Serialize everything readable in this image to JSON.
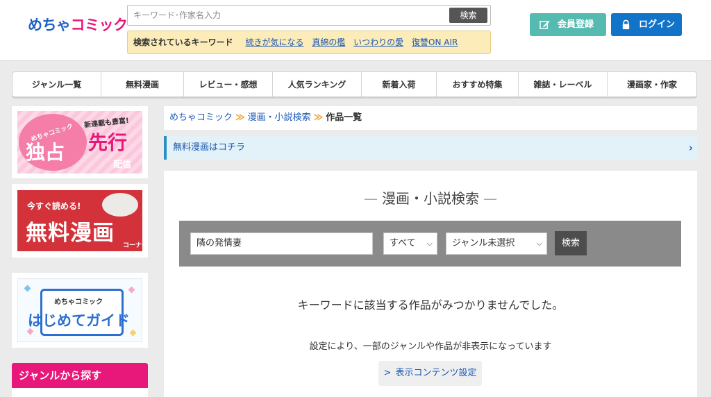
{
  "brand": {
    "logo_part1": "めちゃ",
    "logo_part2": "コミック",
    "accent_pink": "#e8177a",
    "accent_blue": "#1f63c6"
  },
  "header": {
    "search_placeholder": "キーワード･作家名入力",
    "search_button": "検索",
    "keyword_bar_title": "検索されているキーワード",
    "keywords": [
      "続きが気になる",
      "真綿の檻",
      "いつわりの愛",
      "復讐ON AIR"
    ],
    "register_button": "会員登録",
    "register_icon": "pencil-icon",
    "login_button": "ログイン",
    "login_icon": "lock-icon"
  },
  "nav": {
    "items": [
      "ジャンル一覧",
      "無料漫画",
      "レビュー・感想",
      "人気ランキング",
      "新着入荷",
      "おすすめ特集",
      "雑誌・レーベル",
      "漫画家・作家"
    ]
  },
  "sidebar": {
    "banner1": {
      "brand": "めちゃコミック",
      "big1": "独占",
      "small": "新連載も豊富!",
      "big2": "先行",
      "sub": "配信"
    },
    "banner2": {
      "small": "今すぐ読める!",
      "big": "無料漫画",
      "sub": "コーナー"
    },
    "banner3": {
      "small": "めちゃコミック",
      "big": "はじめてガイド"
    },
    "genre_heading": "ジャンルから探す"
  },
  "breadcrumb": {
    "items": [
      "めちゃコミック",
      "漫画・小説検索",
      "作品一覧"
    ],
    "separator": "≫"
  },
  "free_bar": {
    "label": "無料漫画はコチラ",
    "chevron": "›"
  },
  "search_panel": {
    "title": "漫画・小説検索",
    "title_dash": "—",
    "keyword_value": "隣の発情妻",
    "category_value": "すべて",
    "genre_value": "ジャンル未選択",
    "select_arrow": "⌵",
    "submit_label": "検索"
  },
  "results": {
    "no_results": "キーワードに該当する作品がみつかりませんでした。",
    "setting_note": "設定により、一部のジャンルや作品が非表示になっています",
    "display_settings_button": "表示コンテンツ設定",
    "display_settings_prefix": ">"
  }
}
